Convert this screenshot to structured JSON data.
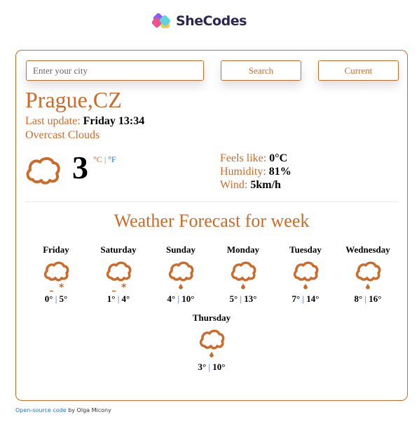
{
  "logo": {
    "text": "SheCodes"
  },
  "search": {
    "placeholder": "Enter your city",
    "value": ""
  },
  "buttons": {
    "search_label": "Search",
    "current_label": "Current"
  },
  "current": {
    "city": "Prague,CZ",
    "last_update_label": "Last update:",
    "last_update_value": "Friday 13:34",
    "description": "Overcast Clouds",
    "icon": "cloud-icon",
    "temperature": "3",
    "unit_celsius": "°C",
    "unit_separator": "|",
    "unit_fahrenheit": "°F",
    "feels_like_label": "Feels like:",
    "feels_like_value": "0°C",
    "humidity_label": "Humidity:",
    "humidity_value": "81%",
    "wind_label": "Wind:",
    "wind_value": "5km/h"
  },
  "forecast": {
    "title": "Weather Forecast for week",
    "days": [
      {
        "name": "Friday",
        "min": "0°",
        "max": "5°",
        "icon": "cloud-snow-icon"
      },
      {
        "name": "Saturday",
        "min": "1°",
        "max": "4°",
        "icon": "cloud-snow-icon"
      },
      {
        "name": "Sunday",
        "min": "4°",
        "max": "10°",
        "icon": "cloud-rain-icon"
      },
      {
        "name": "Monday",
        "min": "5°",
        "max": "13°",
        "icon": "cloud-rain-icon"
      },
      {
        "name": "Tuesday",
        "min": "7°",
        "max": "14°",
        "icon": "cloud-rain-icon"
      },
      {
        "name": "Wednesday",
        "min": "8°",
        "max": "16°",
        "icon": "cloud-rain-icon"
      },
      {
        "name": "Thursday",
        "min": "3°",
        "max": "10°",
        "icon": "cloud-rain-icon"
      }
    ],
    "separator": "|"
  },
  "footer": {
    "link_text": "Open-source code",
    "author_text": " by Olga Micony"
  },
  "colors": {
    "accent": "#cc6a2a",
    "link": "#1a73e8"
  }
}
